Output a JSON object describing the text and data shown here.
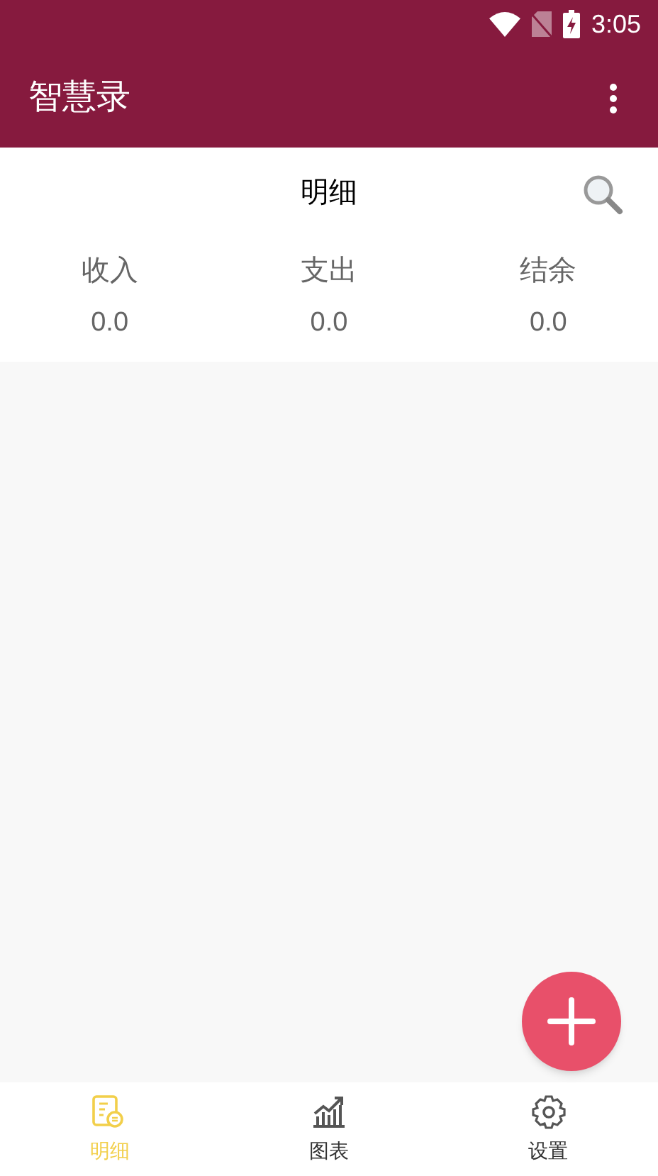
{
  "status_bar": {
    "time": "3:05"
  },
  "app_bar": {
    "title": "智慧录"
  },
  "header": {
    "title": "明细"
  },
  "summary": [
    {
      "label": "收入",
      "value": "0.0"
    },
    {
      "label": "支出",
      "value": "0.0"
    },
    {
      "label": "结余",
      "value": "0.0"
    }
  ],
  "bottom_nav": [
    {
      "label": "明细",
      "selected": true,
      "kind": "ledger"
    },
    {
      "label": "图表",
      "selected": false,
      "kind": "chart"
    },
    {
      "label": "设置",
      "selected": false,
      "kind": "settings"
    }
  ]
}
